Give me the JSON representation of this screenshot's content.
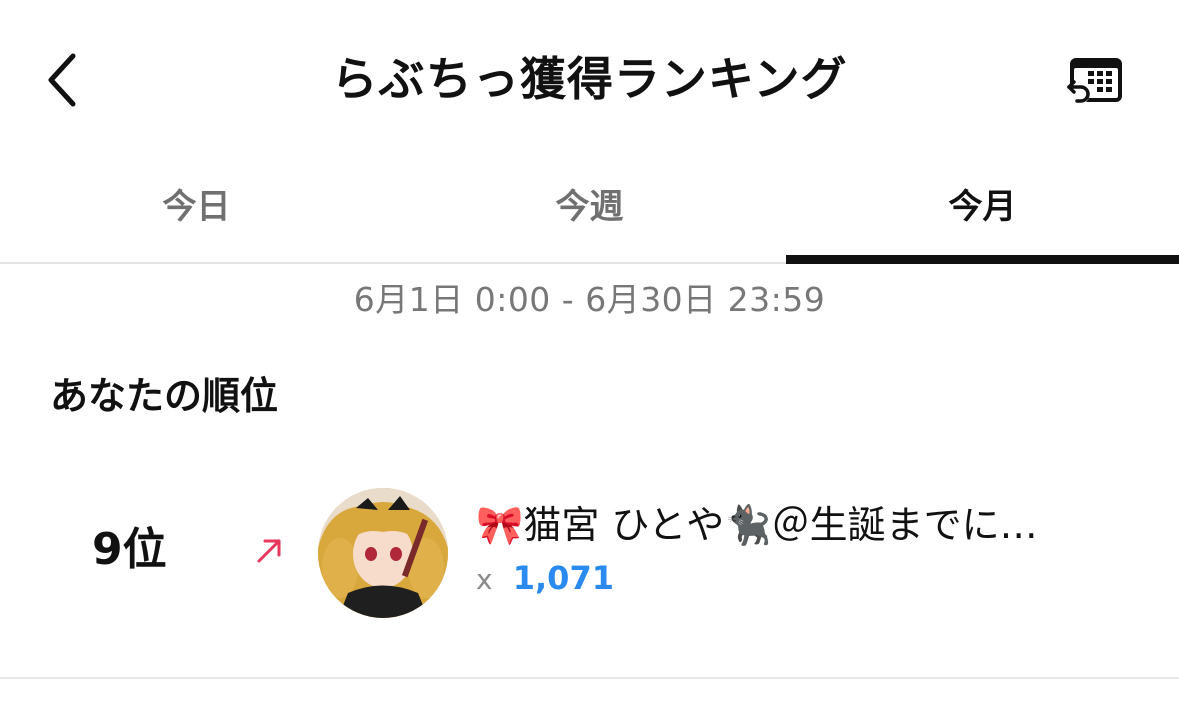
{
  "header": {
    "title": "らぶちっ獲得ランキング",
    "back_icon": "chevron-left-icon",
    "calendar_icon": "calendar-history-icon"
  },
  "tabs": [
    {
      "label": "今日",
      "active": false
    },
    {
      "label": "今週",
      "active": false
    },
    {
      "label": "今月",
      "active": true
    }
  ],
  "period": "6月1日 0:00 - 6月30日 23:59",
  "section": {
    "title": "あなたの順位"
  },
  "my_rank": {
    "rank": "9位",
    "trend_icon": "arrow-up-right-icon",
    "trend_color": "#e8365d",
    "name": "🎀猫宮 ひとや🐈‍⬛＠生誕までに…",
    "score_prefix": "x",
    "score": "1,071",
    "score_color": "#2a8af0"
  }
}
